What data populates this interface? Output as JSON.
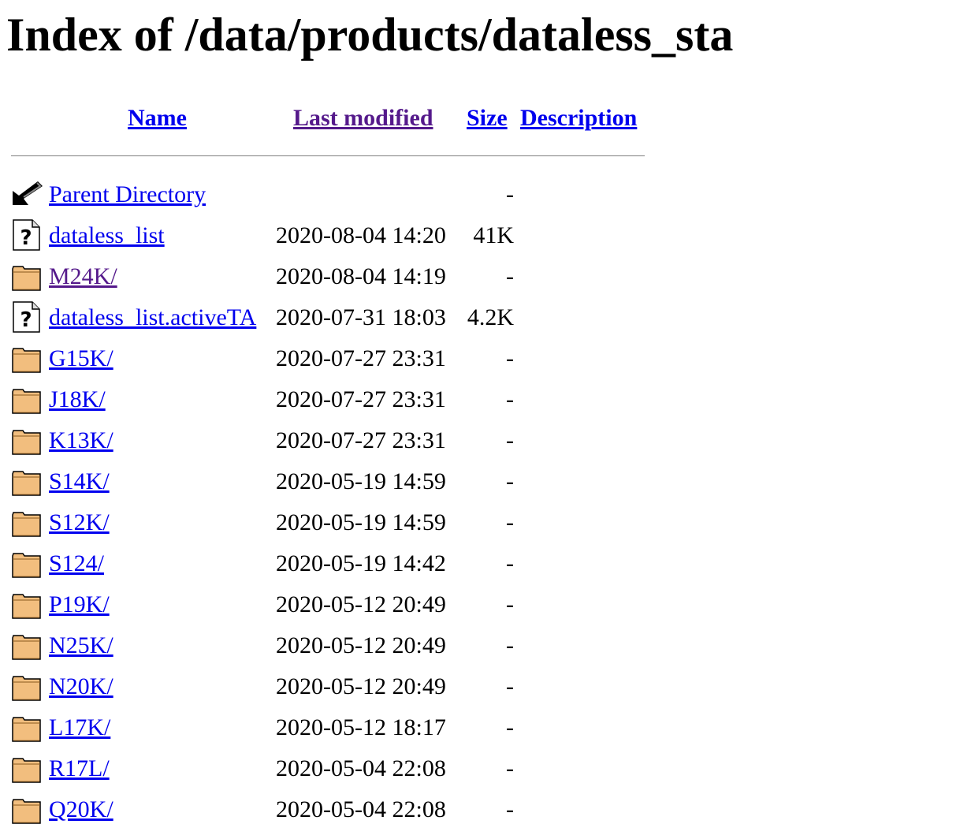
{
  "page": {
    "title": "Index of /data/products/dataless_sta"
  },
  "table": {
    "headers": {
      "name": "Name",
      "last_modified": "Last modified",
      "size": "Size",
      "description": "Description"
    },
    "rows": [
      {
        "icon": "back-arrow-icon",
        "name": "Parent Directory",
        "date": "",
        "size": "-",
        "visited": false
      },
      {
        "icon": "unknown-file-icon",
        "name": "dataless_list",
        "date": "2020-08-04 14:20",
        "size": "41K",
        "visited": false
      },
      {
        "icon": "folder-icon",
        "name": "M24K/",
        "date": "2020-08-04 14:19",
        "size": "-",
        "visited": true
      },
      {
        "icon": "unknown-file-icon",
        "name": "dataless_list.activeTA",
        "date": "2020-07-31 18:03",
        "size": "4.2K",
        "visited": false
      },
      {
        "icon": "folder-icon",
        "name": "G15K/",
        "date": "2020-07-27 23:31",
        "size": "-",
        "visited": false
      },
      {
        "icon": "folder-icon",
        "name": "J18K/",
        "date": "2020-07-27 23:31",
        "size": "-",
        "visited": false
      },
      {
        "icon": "folder-icon",
        "name": "K13K/",
        "date": "2020-07-27 23:31",
        "size": "-",
        "visited": false
      },
      {
        "icon": "folder-icon",
        "name": "S14K/",
        "date": "2020-05-19 14:59",
        "size": "-",
        "visited": false
      },
      {
        "icon": "folder-icon",
        "name": "S12K/",
        "date": "2020-05-19 14:59",
        "size": "-",
        "visited": false
      },
      {
        "icon": "folder-icon",
        "name": "S124/",
        "date": "2020-05-19 14:42",
        "size": "-",
        "visited": false
      },
      {
        "icon": "folder-icon",
        "name": "P19K/",
        "date": "2020-05-12 20:49",
        "size": "-",
        "visited": false
      },
      {
        "icon": "folder-icon",
        "name": "N25K/",
        "date": "2020-05-12 20:49",
        "size": "-",
        "visited": false
      },
      {
        "icon": "folder-icon",
        "name": "N20K/",
        "date": "2020-05-12 20:49",
        "size": "-",
        "visited": false
      },
      {
        "icon": "folder-icon",
        "name": "L17K/",
        "date": "2020-05-12 18:17",
        "size": "-",
        "visited": false
      },
      {
        "icon": "folder-icon",
        "name": "R17L/",
        "date": "2020-05-04 22:08",
        "size": "-",
        "visited": false
      },
      {
        "icon": "folder-icon",
        "name": "Q20K/",
        "date": "2020-05-04 22:08",
        "size": "-",
        "visited": false
      }
    ]
  },
  "colors": {
    "link": "#0000EE",
    "visited_link": "#551A8B",
    "folder_fill": "#F2BE7E"
  }
}
